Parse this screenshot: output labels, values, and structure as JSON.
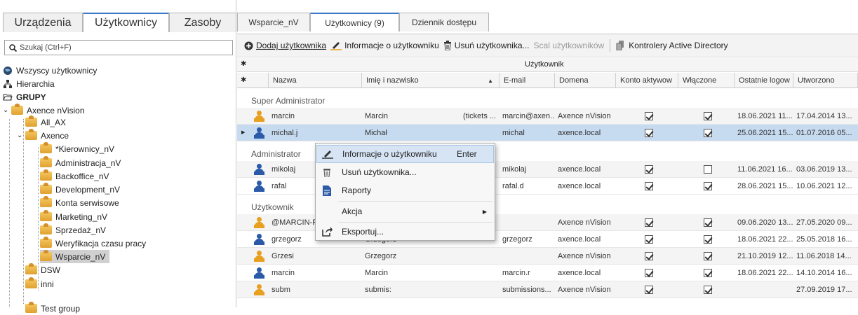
{
  "left_tabs": [
    "Urządzenia",
    "Użytkownicy",
    "Zasoby"
  ],
  "search": {
    "placeholder": "Szukaj (Ctrl+F)"
  },
  "tree": {
    "all_users": "Wszyscy użytkownicy",
    "hierarchy": "Hierarchia",
    "groups": "GRUPY",
    "axence": "Axence nVision",
    "all_ax": "All_AX",
    "axence_sub": "Axence",
    "kierownicy": "*Kierownicy_nV",
    "administracja": "Administracja_nV",
    "backoffice": "Backoffice_nV",
    "development": "Development_nV",
    "konta": "Konta serwisowe",
    "marketing": "Marketing_nV",
    "sprzedaz": "Sprzedaż_nV",
    "weryfikacja": "Weryfikacja czasu pracy",
    "wsparcie": "Wsparcie_nV",
    "dsw": "DSW",
    "inni": "inni",
    "test": "Test group"
  },
  "right_tabs": [
    "Wsparcie_nV",
    "Użytkownicy (9)",
    "Dziennik dostępu"
  ],
  "toolbar": {
    "add_user": "Dodaj użytkownika",
    "user_info": "Informacje o użytkowniku",
    "delete_user": "Usuń użytkownika...",
    "merge_users": "Scal użytkowników",
    "ad_controllers": "Kontrolery Active Directory"
  },
  "grid": {
    "band": "Użytkownik",
    "columns": [
      "Nazwa",
      "Imię i nazwisko",
      "E-mail",
      "Domena",
      "Konto aktywowane",
      "Włączone",
      "Ostatnie logowanie",
      "Utworzono"
    ],
    "column_display": [
      "Nazwa",
      "Imię i nazwisko",
      "E-mail",
      "Domena",
      "Konto aktywow",
      "Włączone",
      "Ostatnie logow",
      "Utworzono"
    ],
    "groups": [
      {
        "name": "Super Administrator",
        "rows": [
          {
            "name": "marcin",
            "fullname": "Marcin",
            "extra": "(tickets ...",
            "email": "marcin@axen...",
            "domain": "Axence nVision",
            "active": true,
            "enabled": true,
            "last": "18.06.2021 11...",
            "created": "17.04.2014 13...",
            "icon": "nv"
          },
          {
            "name": "michal.j",
            "fullname": "Michał",
            "extra": "",
            "email": "michal",
            "domain": "axence.local",
            "active": true,
            "enabled": true,
            "last": "25.06.2021 15...",
            "created": "01.07.2016 05...",
            "icon": "ad",
            "selected": true
          }
        ]
      },
      {
        "name": "Administrator",
        "rows": [
          {
            "name": "mikolaj",
            "fullname": "",
            "extra": "",
            "email": "mikolaj",
            "domain": "axence.local",
            "active": true,
            "enabled": false,
            "last": "11.06.2021 16...",
            "created": "03.06.2019 13...",
            "icon": "ad"
          },
          {
            "name": "rafal",
            "fullname": "",
            "extra": "",
            "email": "rafal.d",
            "domain": "axence.local",
            "active": true,
            "enabled": true,
            "last": "28.06.2021 15...",
            "created": "10.06.2021 12...",
            "icon": "ad"
          }
        ]
      },
      {
        "name": "Użytkownik",
        "rows": [
          {
            "name": "@MARCIN-F",
            "fullname": "",
            "extra": "",
            "email": "",
            "domain": "Axence nVision",
            "active": true,
            "enabled": true,
            "last": "09.06.2020 13...",
            "created": "27.05.2020 09...",
            "icon": "nv"
          },
          {
            "name": "grzegorz",
            "fullname": "Grzegorz",
            "extra": "",
            "email": "grzegorz",
            "domain": "axence.local",
            "active": true,
            "enabled": true,
            "last": "18.06.2021 22...",
            "created": "25.05.2018 16...",
            "icon": "ad"
          },
          {
            "name": "Grzesi",
            "fullname": "Grzegorz",
            "extra": "",
            "email": "",
            "domain": "Axence nVision",
            "active": true,
            "enabled": true,
            "last": "21.10.2019 12...",
            "created": "11.06.2018 14...",
            "icon": "nv"
          },
          {
            "name": "marcin",
            "fullname": "Marcin",
            "extra": "",
            "email": "marcin.r",
            "domain": "axence.local",
            "active": true,
            "enabled": true,
            "last": "18.06.2021 22...",
            "created": "14.10.2014 16...",
            "icon": "ad"
          },
          {
            "name": "subm",
            "fullname": "submis:",
            "extra": "",
            "email": "submissions...",
            "domain": "Axence nVision",
            "active": true,
            "enabled": true,
            "last": "",
            "created": "27.09.2019 17...",
            "icon": "nv"
          }
        ]
      }
    ]
  },
  "context_menu": {
    "info": "Informacje o użytkowniku",
    "info_shortcut": "Enter",
    "delete": "Usuń użytkownika...",
    "reports": "Raporty",
    "action": "Akcja",
    "export": "Eksportuj..."
  },
  "colors": {
    "accent": "#3c78c8",
    "selected_row": "#c6daf0",
    "nv_icon": "#e8a020",
    "ad_icon": "#2a5aa8"
  }
}
